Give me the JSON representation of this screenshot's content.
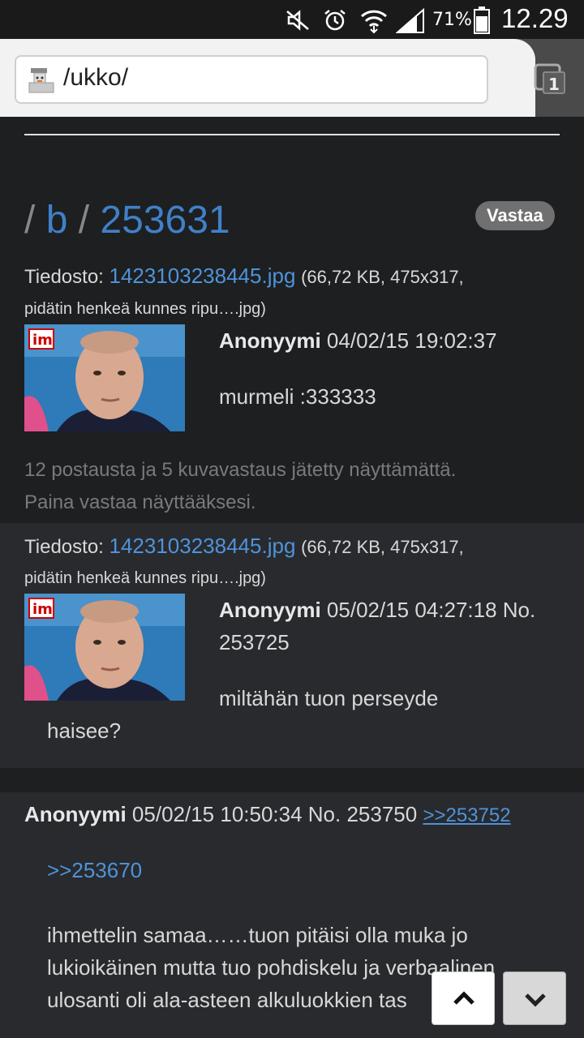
{
  "status_bar": {
    "battery_percent": "71%",
    "time": "12.29"
  },
  "browser": {
    "url": "/ukko/",
    "tab_count": "1"
  },
  "thread": {
    "board_slash_1": "/",
    "board": "b",
    "board_slash_2": "/",
    "thread_no": "253631",
    "reply_label": "Vastaa"
  },
  "op": {
    "file_label": "Tiedosto:",
    "file_name": "1423103238445.jpg",
    "file_meta": "(66,72 KB, 475x317,",
    "file_orig": "pidätin henkeä kunnes ripu….jpg)",
    "name": "Anonyymi",
    "date": "04/02/15 19:02:37",
    "comment": "murmeli :333333"
  },
  "omitted": {
    "line1": "12 postausta ja 5 kuvavastaus jätetty näyttämättä.",
    "line2": "Paina vastaa näyttääksesi."
  },
  "reply1": {
    "file_label": "Tiedosto:",
    "file_name": "1423103238445.jpg",
    "file_meta": "(66,72 KB, 475x317,",
    "file_orig": "pidätin henkeä kunnes ripu….jpg)",
    "name": "Anonyymi",
    "date_no": "05/02/15 04:27:18 No.",
    "post_no": "253725",
    "comment_line1": "miltähän tuon perseyde",
    "comment_line2": "haisee?"
  },
  "reply2": {
    "name": "Anonyymi",
    "date_no": "05/02/15 10:50:34 No. 253750",
    "backlink": ">>253752",
    "quote": ">>253670",
    "comment_line1": "ihmettelin samaa……tuon pitäisi olla muka jo",
    "comment_line2": "lukioikäinen mutta tuo pohdiskelu ja verbaalinen",
    "comment_line3": "ulosanti oli ala-asteen alkuluokkien tas"
  },
  "colors": {
    "background": "#1d1f21",
    "reply_bg": "#282a2e",
    "link": "#4f93d9"
  }
}
